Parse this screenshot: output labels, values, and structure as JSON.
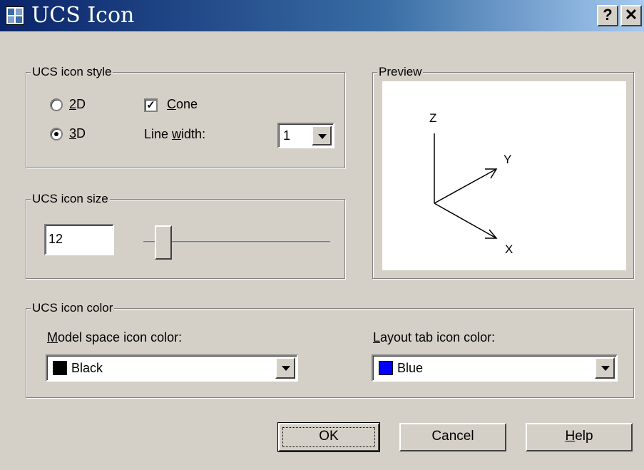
{
  "window": {
    "title": "UCS Icon",
    "help_button": "?",
    "close_button": "✕"
  },
  "style_group": {
    "label": "UCS icon style",
    "radio_2d_prefix": "",
    "radio_2d_key": "2",
    "radio_2d_rest": "D",
    "radio_3d_key": "3",
    "radio_3d_rest": "D",
    "selected": "3D",
    "cone_key": "C",
    "cone_rest": "one",
    "cone_checked": true,
    "line_width_pre": "Line ",
    "line_width_key": "w",
    "line_width_post": "idth:",
    "line_width_value": "1"
  },
  "preview_group": {
    "label": "Preview",
    "axis_z": "Z",
    "axis_y": "Y",
    "axis_x": "X"
  },
  "size_group": {
    "label": "UCS icon size",
    "value": "12",
    "slider_fraction": 0.1
  },
  "color_group": {
    "label": "UCS icon color",
    "model_key": "M",
    "model_rest": "odel space icon color:",
    "model_value": "Black",
    "model_color": "#000000",
    "layout_key": "L",
    "layout_rest": "ayout tab icon color:",
    "layout_value": "Blue",
    "layout_color": "#0000ff"
  },
  "buttons": {
    "ok": "OK",
    "cancel": "Cancel",
    "help_key": "H",
    "help_rest": "elp"
  }
}
